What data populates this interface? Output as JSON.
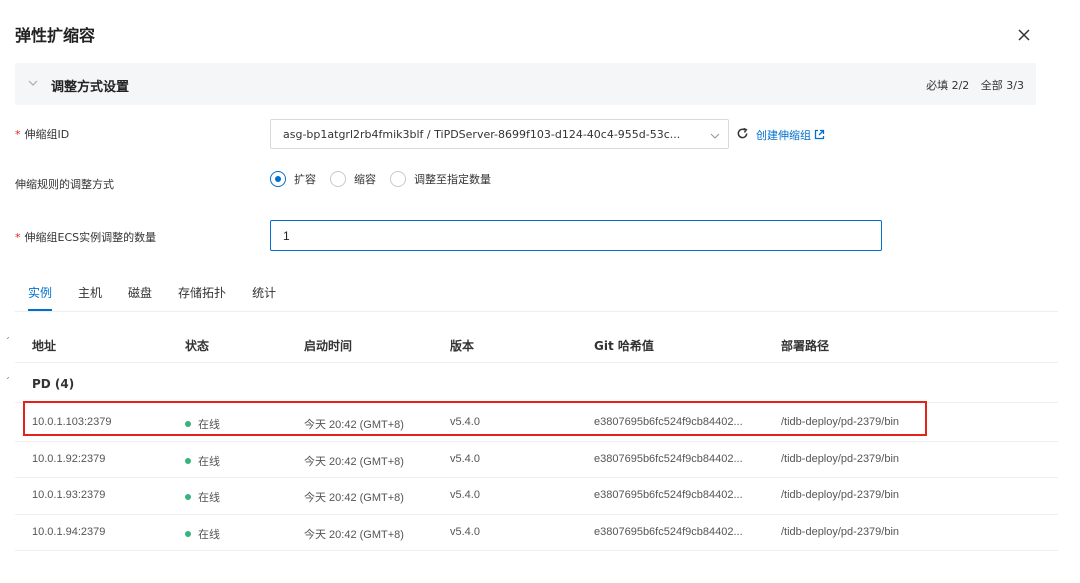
{
  "dialog": {
    "title": "弹性扩缩容"
  },
  "section": {
    "title": "调整方式设置",
    "required_stat": "必填 2/2",
    "total_stat": "全部 3/3"
  },
  "form": {
    "group_label": "伸缩组ID",
    "group_value": "asg-bp1atgrl2rb4fmik3blf / TiPDServer-8699f103-d124-40c4-955d-53c...",
    "create_link": "创建伸缩组",
    "rule_label": "伸缩规则的调整方式",
    "radio_options": [
      "扩容",
      "缩容",
      "调整至指定数量"
    ],
    "radio_selected": "扩容",
    "count_label": "伸缩组ECS实例调整的数量",
    "count_value": "1"
  },
  "tabs": [
    "实例",
    "主机",
    "磁盘",
    "存储拓扑",
    "统计"
  ],
  "active_tab": "实例",
  "table": {
    "columns": [
      "地址",
      "状态",
      "启动时间",
      "版本",
      "Git 哈希值",
      "部署路径"
    ],
    "group": "PD (4)",
    "rows": [
      {
        "address": "10.0.1.103:2379",
        "status": "在线",
        "start_time": "今天 20:42 (GMT+8)",
        "version": "v5.4.0",
        "git_hash": "e3807695b6fc524f9cb84402...",
        "path": "/tidb-deploy/pd-2379/bin"
      },
      {
        "address": "10.0.1.92:2379",
        "status": "在线",
        "start_time": "今天 20:42 (GMT+8)",
        "version": "v5.4.0",
        "git_hash": "e3807695b6fc524f9cb84402...",
        "path": "/tidb-deploy/pd-2379/bin"
      },
      {
        "address": "10.0.1.93:2379",
        "status": "在线",
        "start_time": "今天 20:42 (GMT+8)",
        "version": "v5.4.0",
        "git_hash": "e3807695b6fc524f9cb84402...",
        "path": "/tidb-deploy/pd-2379/bin"
      },
      {
        "address": "10.0.1.94:2379",
        "status": "在线",
        "start_time": "今天 20:42 (GMT+8)",
        "version": "v5.4.0",
        "git_hash": "e3807695b6fc524f9cb84402...",
        "path": "/tidb-deploy/pd-2379/bin"
      }
    ]
  },
  "colors": {
    "accent": "#0070cc",
    "required": "#e2231a",
    "online": "#36b37e",
    "highlight": "#e2231a"
  }
}
